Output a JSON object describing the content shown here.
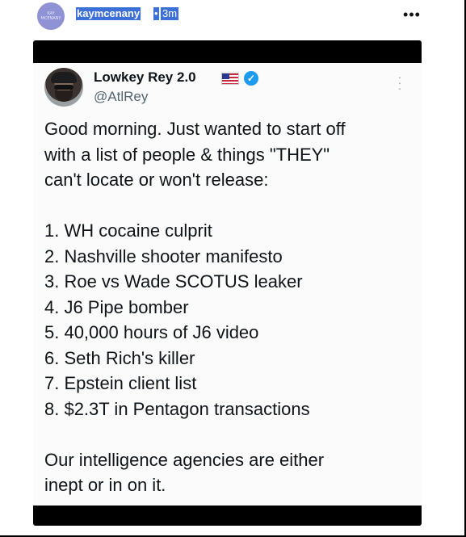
{
  "post": {
    "avatar_text": "KAY MCENANY",
    "username": "kaymcenany",
    "separator": "•",
    "time": "3m",
    "more_icon": "ellipsis-icon"
  },
  "tweet": {
    "display_name": "Lowkey Rey 2.0",
    "flag": "us-flag-icon",
    "verified": "verified-badge-icon",
    "verified_color": "#1d9bf0",
    "handle": "@AtlRey",
    "intro_lines": [
      "Good morning. Just wanted to start off",
      "with a list of people & things \"THEY\"",
      "can't locate or won't release:"
    ],
    "list_items": [
      "1. WH cocaine culprit",
      "2. Nashville shooter manifesto",
      "3. Roe vs Wade SCOTUS leaker",
      "4. J6 Pipe bomber",
      "5. 40,000 hours of J6 video",
      "6. Seth Rich's killer",
      "7. Epstein client list",
      "8. $2.3T in Pentagon transactions"
    ],
    "closing_lines": [
      "Our intelligence agencies are either",
      "inept or in on it."
    ]
  },
  "colors": {
    "selection_highlight": "#3d6fd8",
    "avatar_bg": "#8f92d4",
    "media_frame": "#000000"
  }
}
